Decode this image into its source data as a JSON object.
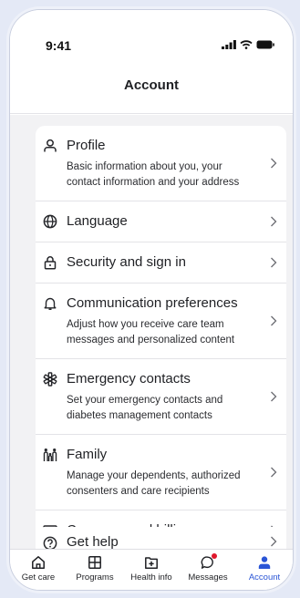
{
  "status_bar": {
    "time": "9:41"
  },
  "header": {
    "title": "Account"
  },
  "account_items": [
    {
      "id": "profile",
      "label": "Profile",
      "description": "Basic information about you, your contact information and your address",
      "icon": "person-icon"
    },
    {
      "id": "language",
      "label": "Language",
      "description": "",
      "icon": "globe-icon"
    },
    {
      "id": "security",
      "label": "Security and sign in",
      "description": "",
      "icon": "lock-icon"
    },
    {
      "id": "communication",
      "label": "Communication preferences",
      "description": "Adjust how you receive care team messages and personalized content",
      "icon": "bell-icon"
    },
    {
      "id": "emergency",
      "label": "Emergency contacts",
      "description": "Set your emergency contacts and diabetes management contacts",
      "icon": "emergency-icon"
    },
    {
      "id": "family",
      "label": "Family",
      "description": "Manage your dependents, authorized consenters and care recipients",
      "icon": "family-icon"
    },
    {
      "id": "billing",
      "label": "Coverage and billing",
      "description": "",
      "icon": "credit-card-icon"
    }
  ],
  "help": {
    "label": "Get help",
    "icon": "help-icon"
  },
  "tab_bar": {
    "accent_color": "#2a55d6",
    "tabs": [
      {
        "label": "Get care",
        "icon": "home-icon"
      },
      {
        "label": "Programs",
        "icon": "grid-icon"
      },
      {
        "label": "Health info",
        "icon": "health-info-icon"
      },
      {
        "label": "Messages",
        "icon": "message-icon"
      },
      {
        "label": "Account",
        "icon": "account-icon"
      }
    ],
    "active_tab": "Account"
  }
}
